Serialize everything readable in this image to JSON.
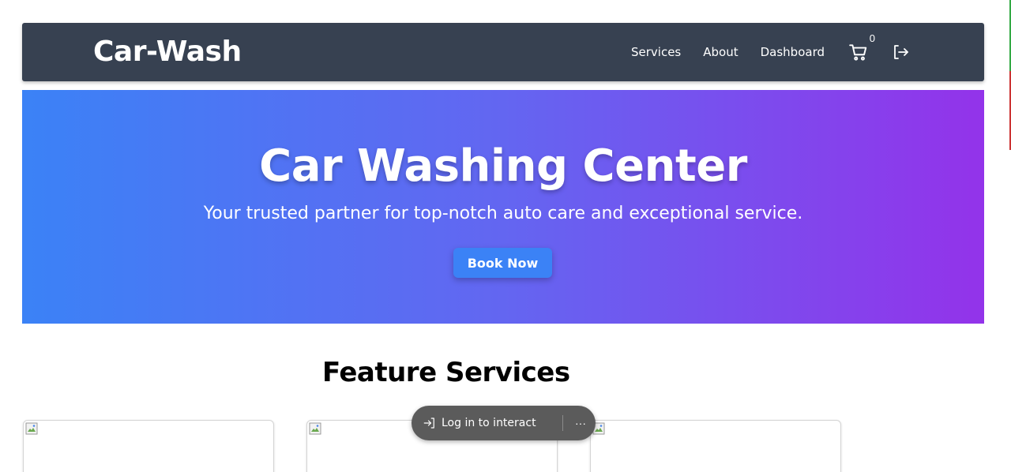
{
  "navbar": {
    "brand": "Car-Wash",
    "links": [
      "Services",
      "About",
      "Dashboard"
    ],
    "cart_count": "0",
    "cart_icon": "cart-icon",
    "logout_icon": "logout-icon"
  },
  "hero": {
    "title": "Car Washing Center",
    "subtitle": "Your trusted partner for top-notch auto care and exceptional service.",
    "button_label": "Book Now"
  },
  "features": {
    "title": "Feature Services",
    "cards": [
      {
        "image_icon": "broken-image-icon"
      },
      {
        "image_icon": "broken-image-icon"
      },
      {
        "image_icon": "broken-image-icon"
      }
    ]
  },
  "overlay": {
    "login_label": "Log in to interact",
    "more_label": "···"
  },
  "colors": {
    "navbar_bg": "#374151",
    "hero_gradient_start": "#3b82f6",
    "hero_gradient_end": "#9333ea",
    "button_bg": "#3b82f6"
  }
}
